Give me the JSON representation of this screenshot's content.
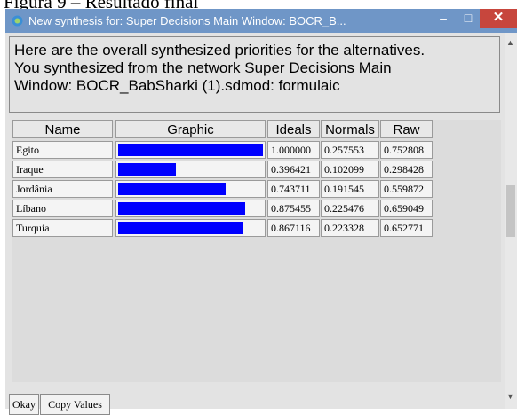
{
  "caption": "Figura 9 – Resultado final",
  "window": {
    "title": "New synthesis for: Super Decisions Main Window: BOCR_B...",
    "minimize_glyph": "–",
    "maximize_glyph": "□",
    "close_glyph": "✕"
  },
  "message": {
    "line1": "Here are the overall synthesized priorities for the alternatives.",
    "line2": "You synthesized from the network Super Decisions Main",
    "line3": "Window: BOCR_BabSharki (1).sdmod: formulaic"
  },
  "table": {
    "headers": [
      "Name",
      "Graphic",
      "Ideals",
      "Normals",
      "Raw"
    ],
    "rows": [
      {
        "name": "Egito",
        "ideal": "1.000000",
        "normal": "0.257553",
        "raw": "0.752808",
        "ideal_value": 1.0
      },
      {
        "name": "Iraque",
        "ideal": "0.396421",
        "normal": "0.102099",
        "raw": "0.298428",
        "ideal_value": 0.396421
      },
      {
        "name": "Jordânia",
        "ideal": "0.743711",
        "normal": "0.191545",
        "raw": "0.559872",
        "ideal_value": 0.743711
      },
      {
        "name": "Líbano",
        "ideal": "0.875455",
        "normal": "0.225476",
        "raw": "0.659049",
        "ideal_value": 0.875455
      },
      {
        "name": "Turquia",
        "ideal": "0.867116",
        "normal": "0.223328",
        "raw": "0.652771",
        "ideal_value": 0.867116
      }
    ]
  },
  "buttons": {
    "okay": "Okay",
    "copy_values": "Copy Values"
  },
  "colors": {
    "bar": "#0000ff",
    "titlebar": "#6f96c7",
    "close": "#c7463d"
  },
  "icons": {
    "app": "super-decisions-app-icon"
  }
}
